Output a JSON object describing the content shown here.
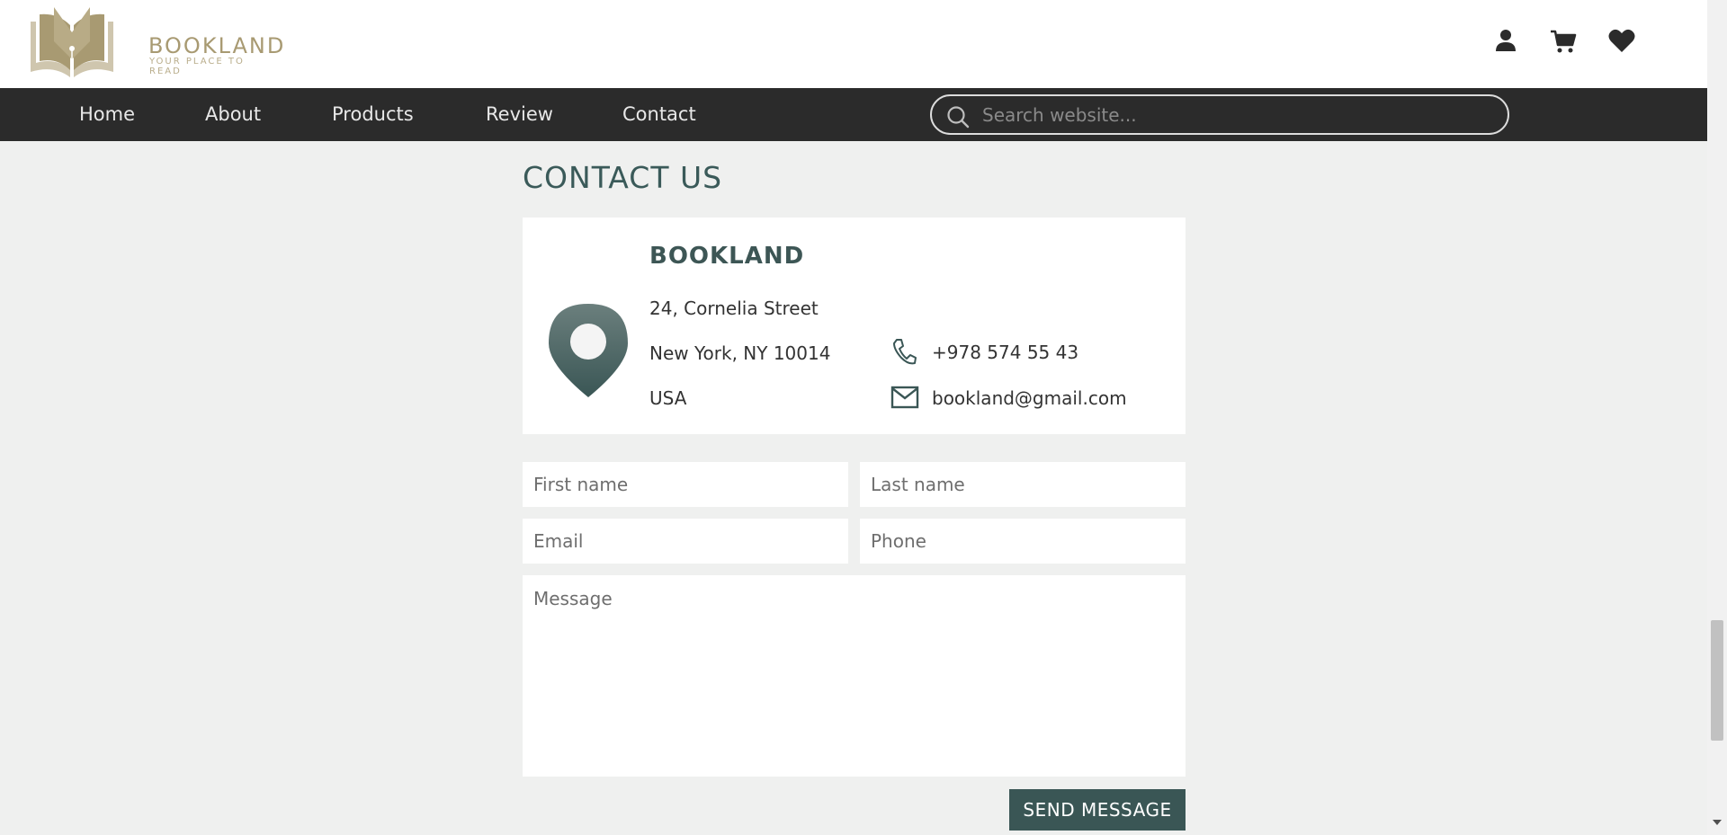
{
  "brand": {
    "name": "BOOKLAND",
    "tagline": "YOUR PLACE TO READ",
    "color": "#a89a72"
  },
  "header_icons": [
    "user-icon",
    "cart-icon",
    "heart-icon"
  ],
  "nav": {
    "items": [
      {
        "label": "Home"
      },
      {
        "label": "About"
      },
      {
        "label": "Products"
      },
      {
        "label": "Review"
      },
      {
        "label": "Contact"
      }
    ],
    "search_placeholder": "Search website..."
  },
  "page": {
    "title": "CONTACT US"
  },
  "contact_card": {
    "company": "BOOKLAND",
    "address": [
      "24, Cornelia Street",
      "New York, NY 10014",
      "USA"
    ],
    "phone": "+978 574 55 43",
    "email": "bookland@gmail.com"
  },
  "form": {
    "first_name_placeholder": "First name",
    "last_name_placeholder": "Last name",
    "email_placeholder": "Email",
    "phone_placeholder": "Phone",
    "message_placeholder": "Message",
    "submit_label": "SEND MESSAGE"
  },
  "colors": {
    "accent": "#3a5655",
    "nav_bg": "#2b2b2b",
    "page_bg": "#eff0ef"
  }
}
